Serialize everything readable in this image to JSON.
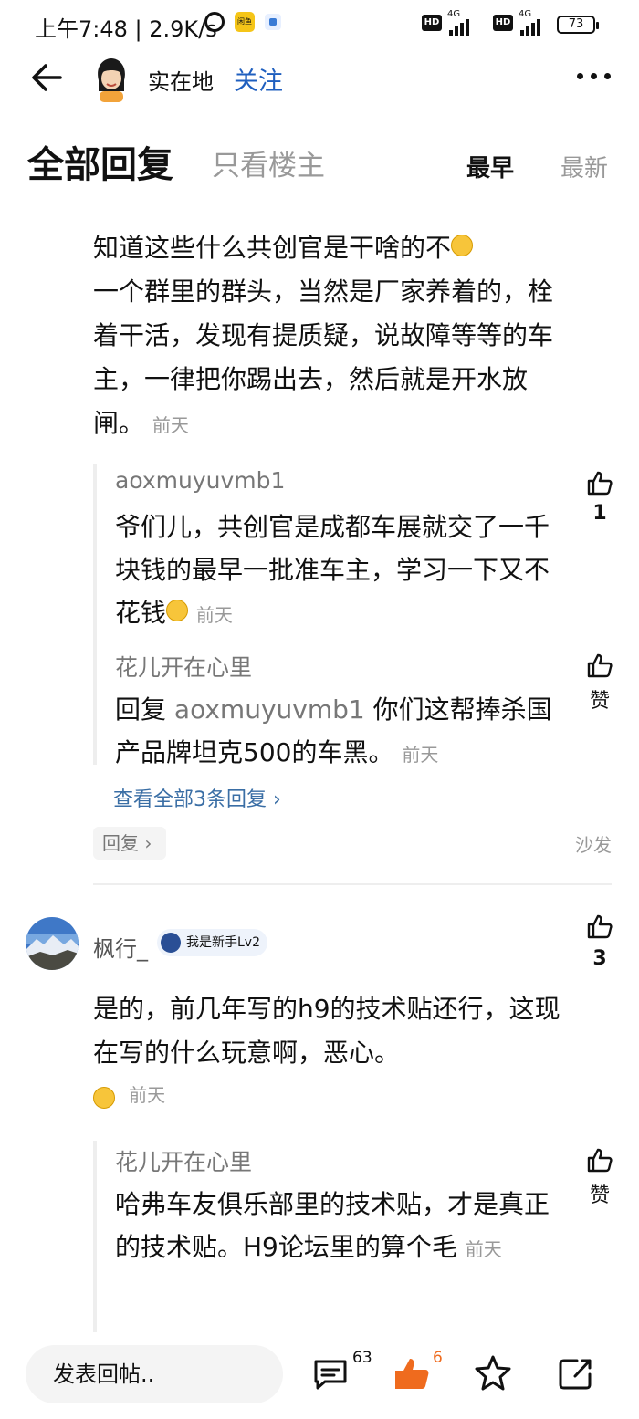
{
  "status_bar": {
    "time": "上午7:48 | 2.9K/s",
    "app_label": "闲鱼",
    "hd": "HD",
    "net": "4G",
    "battery": "73"
  },
  "nav": {
    "title": "实在地",
    "follow": "关注"
  },
  "tabs": {
    "all_replies": "全部回复",
    "op_only": "只看楼主",
    "sort_earliest": "最早",
    "sort_latest": "最新"
  },
  "comment1": {
    "text": "知道这些什么共创官是干啥的不",
    "text2": "一个群里的群头，当然是厂家养着的，栓着干活，发现有提质疑，说故障等等的车主，一律把你踢出去，然后就是开水放闸。",
    "time": "前天",
    "replies": [
      {
        "author": "aoxmuyuvmb1",
        "text": "爷们儿，共创官是成都车展就交了一千块钱的最早一批准车主，学习一下又不花钱",
        "time": "前天",
        "likes": "1"
      },
      {
        "author": "花儿开在心里",
        "reply_prefix": "回复",
        "mention": "aoxmuyuvmb1",
        "text": "你们这帮捧杀国产品牌坦克500的车黑。",
        "time": "前天",
        "likes": "赞"
      }
    ],
    "view_all": "查看全部3条回复",
    "reply_button": "回复",
    "floor": "沙发"
  },
  "comment2": {
    "author": "枫行_",
    "badge": "我是新手Lv2",
    "likes": "3",
    "text": "是的，前几年写的h9的技术贴还行，这现在写的什么玩意啊，恶心。",
    "time": "前天",
    "replies": [
      {
        "author": "花儿开在心里",
        "text": "哈弗车友俱乐部里的技术贴，才是真正的技术贴。H9论坛里的算个毛",
        "time": "前天",
        "likes": "赞"
      }
    ]
  },
  "bottom_bar": {
    "input_placeholder": "发表回帖..",
    "comment_count": "63",
    "like_count": "6"
  },
  "colors": {
    "link_blue": "#1f5fbf",
    "like_orange": "#ef6b1e",
    "muted_gray": "#999999"
  }
}
